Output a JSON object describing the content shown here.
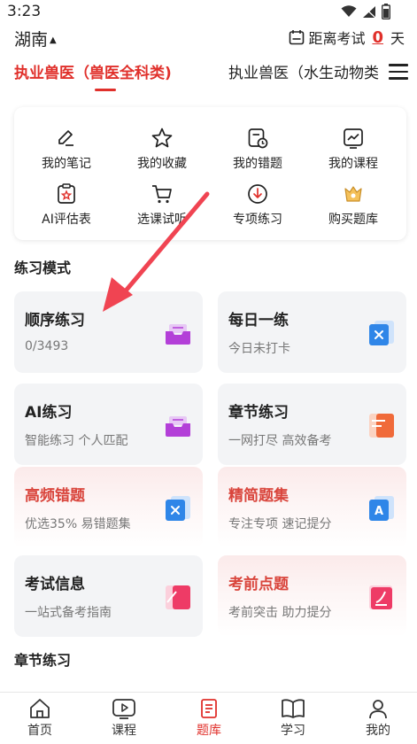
{
  "status": {
    "time": "3:23"
  },
  "header": {
    "region": "湖南",
    "countdown_label": "距离考试",
    "countdown_days": "0",
    "countdown_unit": "天"
  },
  "tabs": [
    {
      "label": "执业兽医（兽医全科类)",
      "active": true
    },
    {
      "label": "执业兽医（水生动物类",
      "active": false
    }
  ],
  "quick_links": [
    {
      "label": "我的笔记",
      "icon": "pencil-note-icon"
    },
    {
      "label": "我的收藏",
      "icon": "star-icon"
    },
    {
      "label": "我的错题",
      "icon": "wrong-questions-icon"
    },
    {
      "label": "我的课程",
      "icon": "course-chart-icon"
    },
    {
      "label": "AI评估表",
      "icon": "ai-clipboard-icon"
    },
    {
      "label": "选课试听",
      "icon": "shopping-cart-icon"
    },
    {
      "label": "专项练习",
      "icon": "download-cloud-icon"
    },
    {
      "label": "购买题库",
      "icon": "crown-shop-icon"
    }
  ],
  "practice": {
    "title": "练习模式",
    "modes": [
      {
        "title": "顺序练习",
        "subtitle": "0/3493",
        "icon": "purple-inbox-icon",
        "highlight": false
      },
      {
        "title": "每日一练",
        "subtitle": "今日未打卡",
        "icon": "blue-calendar-icon",
        "highlight": false
      },
      {
        "title": "AI练习",
        "subtitle": "智能练习 个人匹配",
        "icon": "purple-inbox-icon",
        "highlight": false
      },
      {
        "title": "章节练习",
        "subtitle": "一网打尽 高效备考",
        "icon": "orange-book-icon",
        "highlight": false
      },
      {
        "title": "高频错题",
        "subtitle": "优选35% 易错题集",
        "icon": "blue-calendar-icon",
        "highlight": true
      },
      {
        "title": "精简题集",
        "subtitle": "专注专项 速记提分",
        "icon": "blue-a-book-icon",
        "highlight": true
      },
      {
        "title": "考试信息",
        "subtitle": "一站式备考指南",
        "icon": "pink-book-icon",
        "highlight": false
      },
      {
        "title": "考前点题",
        "subtitle": "考前突击 助力提分",
        "icon": "pink-pen-book-icon",
        "highlight": true
      }
    ]
  },
  "chapter": {
    "title": "章节练习"
  },
  "bottom_nav": [
    {
      "label": "首页",
      "icon": "home-icon",
      "active": false
    },
    {
      "label": "课程",
      "icon": "video-play-icon",
      "active": false
    },
    {
      "label": "题库",
      "icon": "question-bank-icon",
      "active": true
    },
    {
      "label": "学习",
      "icon": "open-book-icon",
      "active": false
    },
    {
      "label": "我的",
      "icon": "profile-icon",
      "active": false
    }
  ],
  "colors": {
    "accent": "#e0302b",
    "card_bg": "#f3f4f6",
    "highlight_title": "#d9453c"
  }
}
